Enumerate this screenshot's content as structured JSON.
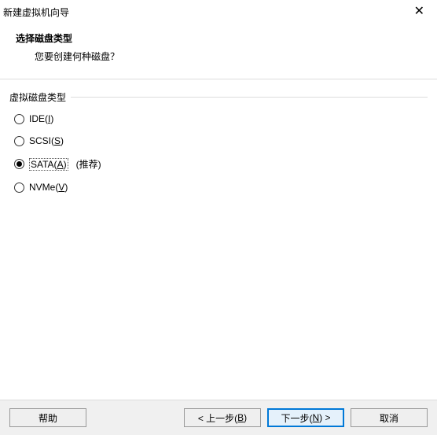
{
  "window": {
    "title": "新建虚拟机向导"
  },
  "header": {
    "title": "选择磁盘类型",
    "subtitle": "您要创建何种磁盘？"
  },
  "group": {
    "label": "虚拟磁盘类型",
    "options": {
      "ide": {
        "prefix": "IDE(",
        "key": "I",
        "suffix": ")"
      },
      "scsi": {
        "prefix": "SCSI(",
        "key": "S",
        "suffix": ")"
      },
      "sata": {
        "prefix": "SATA(",
        "key": "A",
        "suffix": ")",
        "extra": "(推荐)"
      },
      "nvme": {
        "prefix": "NVMe(",
        "key": "V",
        "suffix": ")"
      }
    }
  },
  "buttons": {
    "help": "帮助",
    "back_prefix": "< 上一步(",
    "back_key": "B",
    "back_suffix": ")",
    "next_prefix": "下一步(",
    "next_key": "N",
    "next_suffix": ") >",
    "cancel": "取消"
  }
}
